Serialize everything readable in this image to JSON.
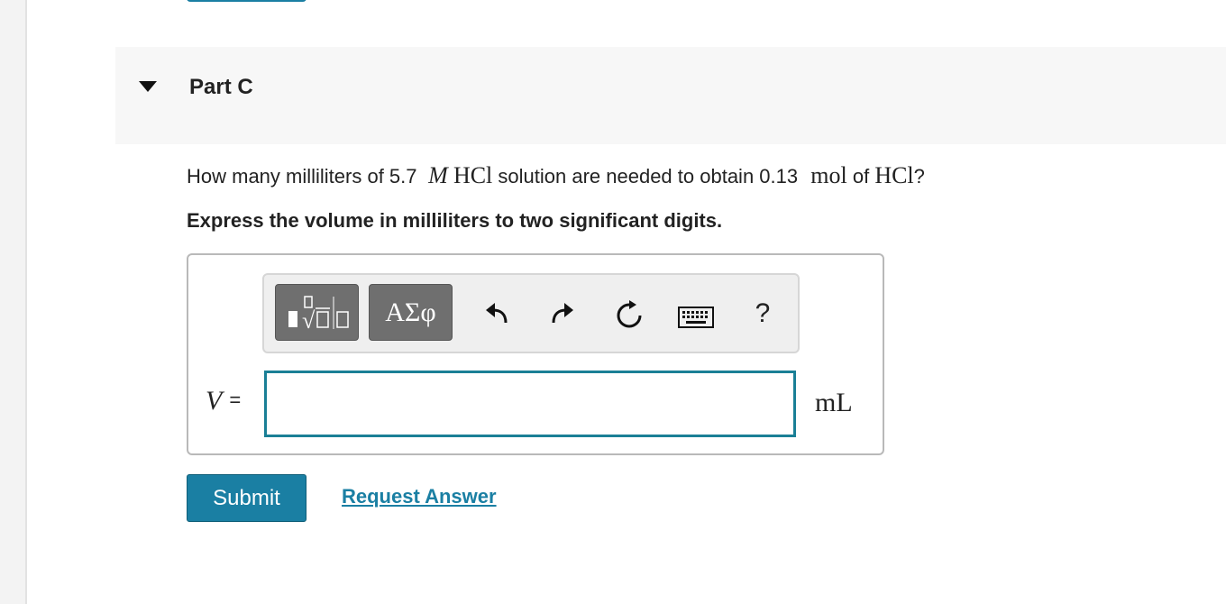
{
  "part": {
    "title": "Part C"
  },
  "question": {
    "prefix": "How many milliliters of 5.7",
    "molarity_unit": "M",
    "compound1": "HCl",
    "middle": "solution are needed to obtain 0.13",
    "mol_unit": "mol",
    "of": "of",
    "compound2": "HCl",
    "suffix": "?"
  },
  "instruction": "Express the volume in milliliters to two significant digits.",
  "toolbar": {
    "templates_icon": "templates-icon",
    "greek_label": "ΑΣφ",
    "undo_icon": "undo-icon",
    "redo_icon": "redo-icon",
    "reset_icon": "reset-icon",
    "keyboard_icon": "keyboard-icon",
    "help_label": "?"
  },
  "answer": {
    "variable": "V",
    "equals": "=",
    "value": "",
    "unit": "mL"
  },
  "actions": {
    "submit_label": "Submit",
    "request_answer_label": "Request Answer"
  },
  "colors": {
    "accent": "#1a7fa3",
    "input_border": "#1a7f96",
    "tool_button": "#6f6f6f"
  }
}
